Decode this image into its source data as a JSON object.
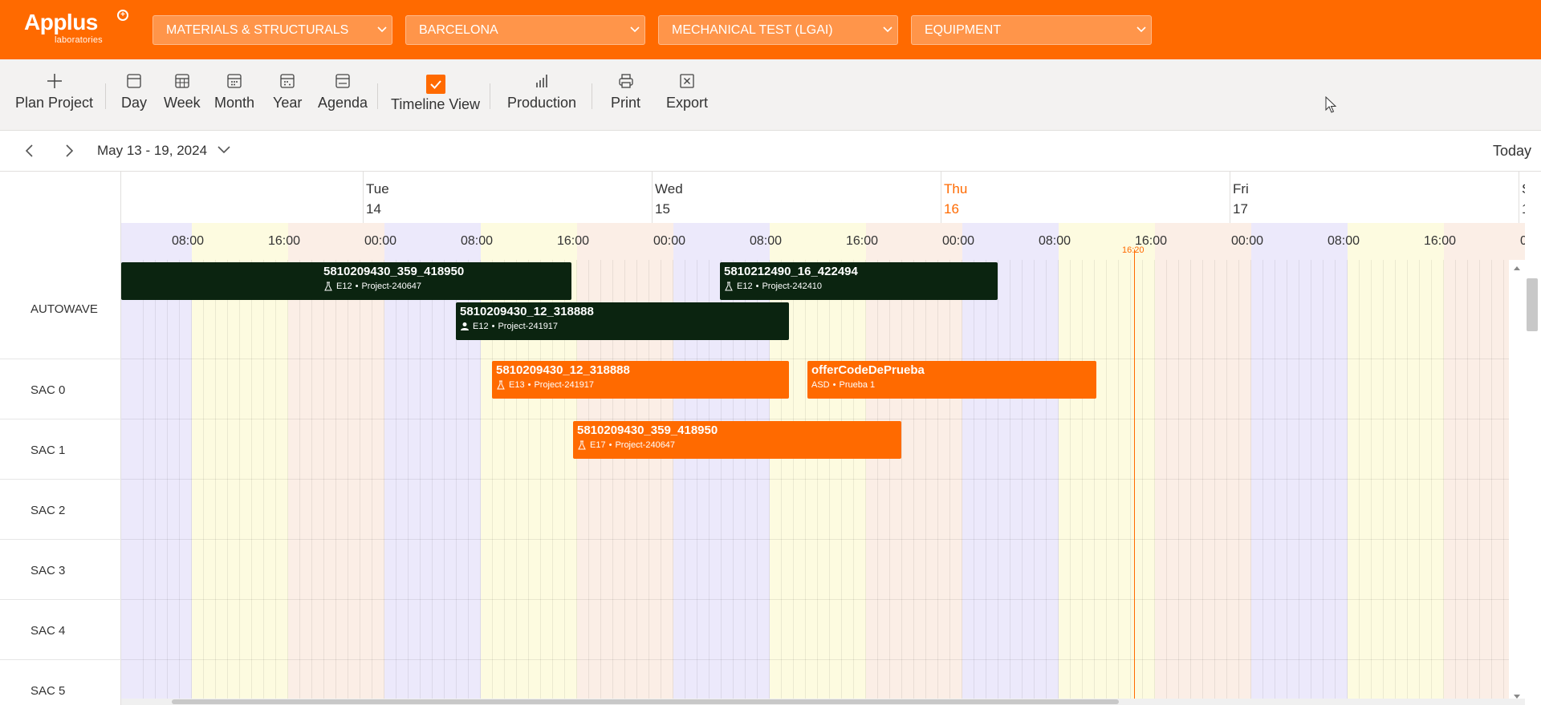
{
  "header": {
    "logo": {
      "brand": "Applus",
      "sub": "laboratories",
      "mark": "+"
    },
    "dropdowns": [
      {
        "value": "MATERIALS & STRUCTURALS"
      },
      {
        "value": "BARCELONA"
      },
      {
        "value": "MECHANICAL TEST (LGAI)"
      },
      {
        "value": "EQUIPMENT"
      }
    ]
  },
  "toolbar": {
    "plan_project": "Plan Project",
    "day": "Day",
    "week": "Week",
    "month": "Month",
    "year": "Year",
    "agenda": "Agenda",
    "timeline_view": "Timeline View",
    "production": "Production",
    "print": "Print",
    "export": "Export"
  },
  "nav": {
    "range": "May 13 - 19, 2024",
    "today": "Today"
  },
  "schedule": {
    "days": [
      {
        "name": "Tue",
        "num": "14"
      },
      {
        "name": "Wed",
        "num": "15"
      },
      {
        "name": "Thu",
        "num": "16"
      },
      {
        "name": "Fri",
        "num": "17"
      },
      {
        "name": "S",
        "num": "1"
      }
    ],
    "hours": [
      "08:00",
      "16:00",
      "00:00",
      "08:00",
      "16:00",
      "00:00",
      "08:00",
      "16:00",
      "00:00",
      "08:00",
      "16:00",
      "00:00",
      "08:00",
      "16:00",
      "0"
    ],
    "now": "16:20",
    "resources": [
      "AUTOWAVE",
      "SAC 0",
      "SAC 1",
      "SAC 2",
      "SAC 3",
      "SAC 4",
      "SAC 5"
    ],
    "events": [
      {
        "title": "5810209430_359_418950",
        "code": "E12",
        "project": "Project-240647",
        "icon": "flask-icon",
        "color": "dark"
      },
      {
        "title": "5810212490_16_422494",
        "code": "E12",
        "project": "Project-242410",
        "icon": "flask-icon",
        "color": "dark"
      },
      {
        "title": "5810209430_12_318888",
        "code": "E12",
        "project": "Project-241917",
        "icon": "person-icon",
        "color": "dark"
      },
      {
        "title": "5810209430_12_318888",
        "code": "E13",
        "project": "Project-241917",
        "icon": "flask-icon",
        "color": "orange"
      },
      {
        "title": "offerCodeDePrueba",
        "code": "ASD",
        "project": "Prueba 1",
        "icon": "",
        "color": "orange"
      },
      {
        "title": "5810209430_359_418950",
        "code": "E17",
        "project": "Project-240647",
        "icon": "flask-icon",
        "color": "orange"
      }
    ]
  },
  "colors": {
    "brand": "#ff6a00",
    "dark_event": "#0b2410"
  }
}
